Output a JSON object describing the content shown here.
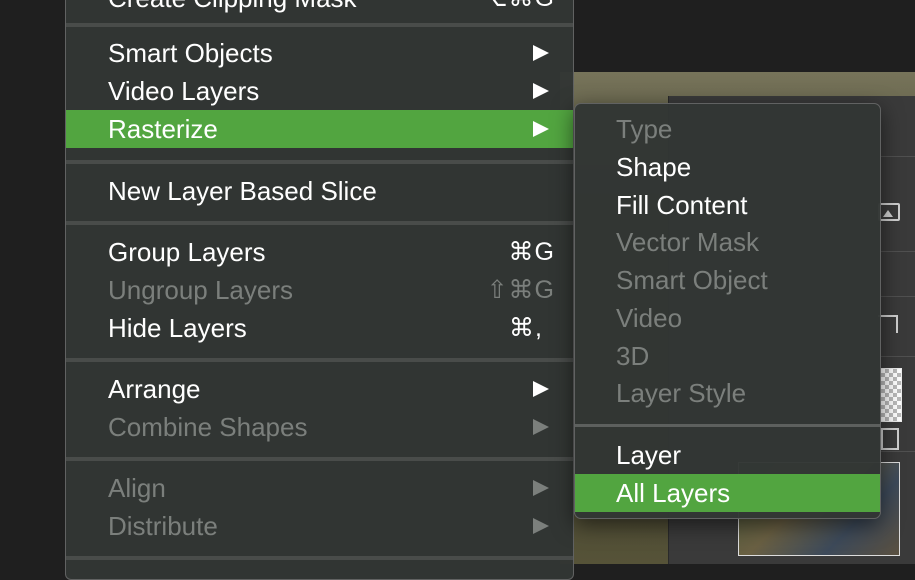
{
  "main_menu": {
    "top_item": {
      "label": "Create Clipping Mask",
      "shortcut": "⌥⌘G"
    },
    "items": [
      {
        "label": "Smart Objects",
        "submenu": true
      },
      {
        "label": "Video Layers",
        "submenu": true
      },
      {
        "label": "Rasterize",
        "submenu": true,
        "highlighted": true
      },
      {
        "label": "New Layer Based Slice"
      },
      {
        "label": "Group Layers",
        "shortcut": "⌘G"
      },
      {
        "label": "Ungroup Layers",
        "shortcut": "⇧⌘G",
        "disabled": true
      },
      {
        "label": "Hide Layers",
        "shortcut": "⌘,"
      },
      {
        "label": "Arrange",
        "submenu": true
      },
      {
        "label": "Combine Shapes",
        "submenu": true,
        "disabled": true
      },
      {
        "label": "Align",
        "submenu": true,
        "disabled": true
      },
      {
        "label": "Distribute",
        "submenu": true,
        "disabled": true
      }
    ]
  },
  "rasterize_submenu": {
    "items": [
      {
        "label": "Type",
        "disabled": true
      },
      {
        "label": "Shape"
      },
      {
        "label": "Fill Content"
      },
      {
        "label": "Vector Mask",
        "disabled": true
      },
      {
        "label": "Smart Object",
        "disabled": true
      },
      {
        "label": "Video",
        "disabled": true
      },
      {
        "label": "3D",
        "disabled": true
      },
      {
        "label": "Layer Style",
        "disabled": true
      },
      {
        "label": "Layer"
      },
      {
        "label": "All Layers",
        "highlighted": true
      }
    ]
  },
  "colors": {
    "highlight": "#52a540",
    "menu_bg": "#323634",
    "text": "#ffffff",
    "disabled_text": "#7b7f7c"
  }
}
